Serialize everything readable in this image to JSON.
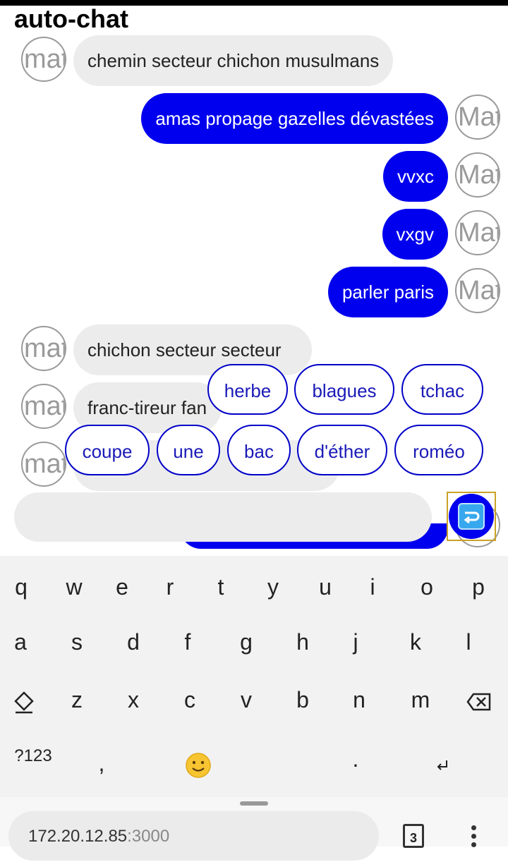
{
  "app": {
    "title": "auto-chat"
  },
  "avatars": {
    "lower": "mat",
    "upper": "Mat"
  },
  "messages": [
    {
      "text": "chemin secteur chichon musulmans",
      "side": "left"
    },
    {
      "text": "amas propage gazelles dévastées",
      "side": "right"
    },
    {
      "text": "vvxc",
      "side": "right"
    },
    {
      "text": "vxgv",
      "side": "right"
    },
    {
      "text": "parler paris",
      "side": "right"
    },
    {
      "text": "chichon secteur secteur",
      "side": "left"
    },
    {
      "text": "franc-tireur fan",
      "side": "left"
    },
    {
      "text": "",
      "side": "left"
    }
  ],
  "suggestions": {
    "row1": [
      "herbe",
      "blagues",
      "tchac"
    ],
    "row2": [
      "coupe",
      "une",
      "bac",
      "d'éther",
      "roméo"
    ]
  },
  "composer": {
    "value": "",
    "placeholder": ""
  },
  "keyboard": {
    "row1": [
      "q",
      "w",
      "e",
      "r",
      "t",
      "y",
      "u",
      "i",
      "o",
      "p"
    ],
    "row2": [
      "a",
      "s",
      "d",
      "f",
      "g",
      "h",
      "j",
      "k",
      "l"
    ],
    "row3": [
      "z",
      "x",
      "c",
      "v",
      "b",
      "n",
      "m"
    ],
    "symbols_label": "?123",
    "comma": ",",
    "period": ".",
    "shift_icon": "shift-icon",
    "backspace_icon": "backspace-icon",
    "enter_icon": "enter-icon",
    "emoji_icon": "emoji-icon"
  },
  "browser": {
    "url_host": "172.20.12.85",
    "url_port": ":3000",
    "tab_count": "3"
  },
  "colors": {
    "accent": "#0000ee",
    "chip_border": "#0000c8",
    "bubble_left": "#ececec"
  }
}
